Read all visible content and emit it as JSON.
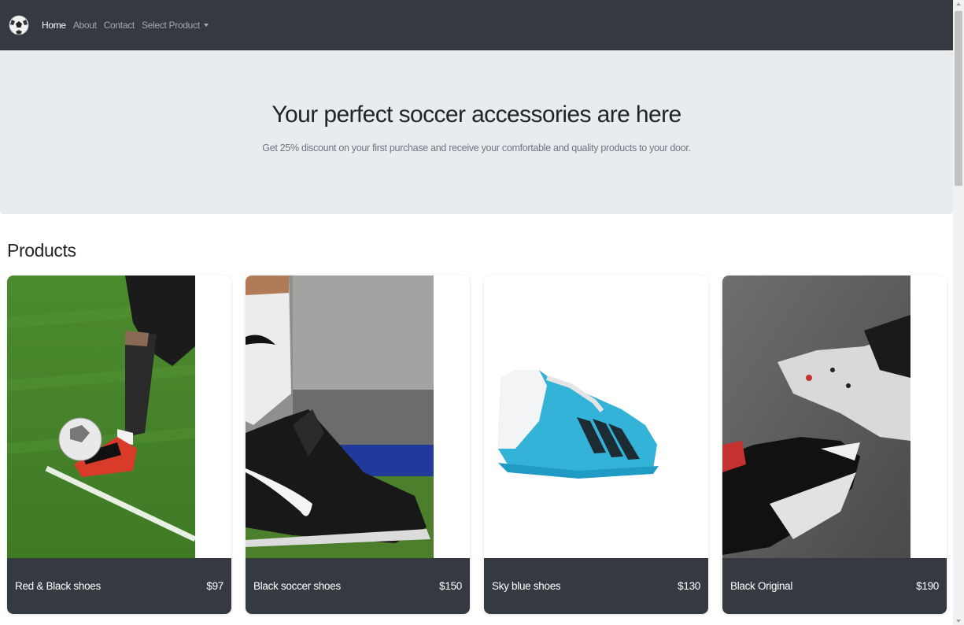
{
  "nav": {
    "links": [
      {
        "label": "Home"
      },
      {
        "label": "About"
      },
      {
        "label": "Contact"
      },
      {
        "label": "Select Product"
      }
    ]
  },
  "hero": {
    "title": "Your perfect soccer accessories are here",
    "subtitle": "Get 25% discount on your first purchase and receive your comfortable and quality products to your door."
  },
  "products_section": {
    "title": "Products",
    "items": [
      {
        "name": "Red & Black shoes",
        "price": "$97"
      },
      {
        "name": "Black soccer shoes",
        "price": "$150"
      },
      {
        "name": "Sky blue shoes",
        "price": "$130"
      },
      {
        "name": "Black Original",
        "price": "$190"
      }
    ]
  },
  "colors": {
    "navbar": "#343a40",
    "hero_bg": "#e9ecef",
    "card_footer": "#343a40"
  }
}
